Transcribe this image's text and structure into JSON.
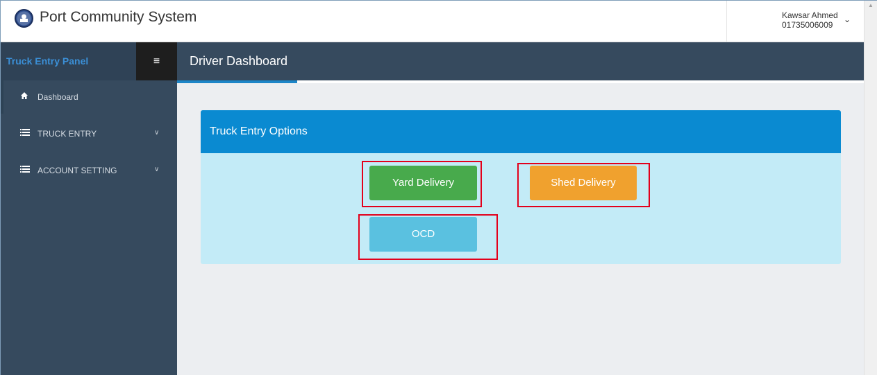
{
  "header": {
    "app_title": "Port Community System",
    "user_name": "Kawsar Ahmed",
    "user_phone": "01735006009",
    "user_menu_icon": "chevron-down-icon"
  },
  "sidebar": {
    "panel_title": "Truck Entry Panel",
    "toggle_icon": "hamburger-icon",
    "items": [
      {
        "label": "Dashboard",
        "icon": "home-icon",
        "has_submenu": false
      },
      {
        "label": "TRUCK ENTRY",
        "icon": "list-icon",
        "has_submenu": true
      },
      {
        "label": "ACCOUNT SETTING",
        "icon": "list-icon",
        "has_submenu": true
      }
    ]
  },
  "main": {
    "page_title": "Driver Dashboard",
    "panel": {
      "title": "Truck Entry Options",
      "buttons": [
        {
          "label": "Yard Delivery",
          "color": "#48aa4c"
        },
        {
          "label": "Shed Delivery",
          "color": "#f0a12e"
        },
        {
          "label": "OCD",
          "color": "#5ac1e0"
        }
      ]
    }
  },
  "colors": {
    "sidebar_bg": "#364a5e",
    "accent_blue": "#0a8ad1",
    "panel_bg": "#c3ebf7",
    "highlight_red": "#e3001b"
  }
}
